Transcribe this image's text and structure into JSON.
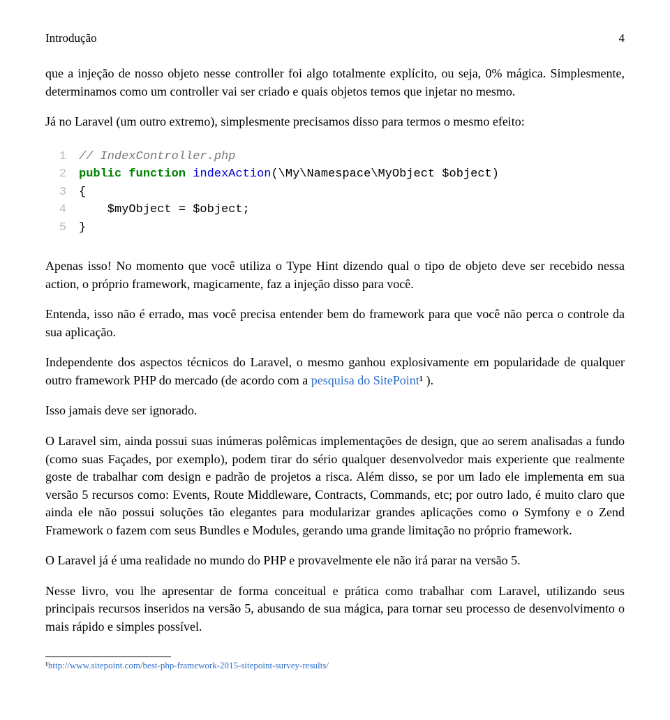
{
  "header": {
    "title": "Introdução",
    "page_number": "4"
  },
  "paragraphs": {
    "p1": "que a injeção de nosso objeto nesse controller foi algo totalmente explícito, ou seja, 0% mágica. Simplesmente, determinamos como um controller vai ser criado e quais objetos temos que injetar no mesmo.",
    "p2": "Já no Laravel (um outro extremo), simplesmente precisamos disso para termos o mesmo efeito:",
    "p3": "Apenas isso! No momento que você utiliza o Type Hint dizendo qual o tipo de objeto deve ser recebido nessa action, o próprio framework, magicamente, faz a injeção disso para você.",
    "p4": "Entenda, isso não é errado, mas você precisa entender bem do framework para que você não perca o controle da sua aplicação.",
    "p5_a": "Independente dos aspectos técnicos do Laravel, o mesmo ganhou explosivamente em popularidade de qualquer outro framework PHP do mercado (de acordo com a ",
    "p5_link": "pesquisa do SitePoint",
    "p5_sup": "¹",
    "p5_b": " ).",
    "p6": "Isso jamais deve ser ignorado.",
    "p7": "O Laravel sim, ainda possui suas inúmeras polêmicas implementações de design, que ao serem analisadas a fundo (como suas Façades, por exemplo), podem tirar do sério qualquer desenvolvedor mais experiente que realmente goste de trabalhar com design e padrão de projetos a risca. Além disso, se por um lado ele implementa em sua versão 5 recursos como: Events, Route Middleware, Contracts, Commands, etc; por outro lado, é muito claro que ainda ele não possui soluções tão elegantes para modularizar grandes aplicações como o Symfony e o Zend Framework o fazem com seus Bundles e Modules, gerando uma grande limitação no próprio framework.",
    "p8": "O Laravel já é uma realidade no mundo do PHP e provavelmente ele não irá parar na versão 5.",
    "p9": "Nesse livro, vou lhe apresentar de forma conceitual e prática como trabalhar com Laravel, utilizando seus principais recursos inseridos na versão 5, abusando de sua mágica, para tornar seu processo de desenvolvimento o mais rápido e simples possível."
  },
  "code": {
    "lines": [
      {
        "n": "1",
        "comment": "// IndexController.php"
      },
      {
        "n": "2",
        "kw1": "public",
        "kw2": "function",
        "name": " indexAction",
        "rest": "(\\My\\Namespace\\MyObject $object)"
      },
      {
        "n": "3",
        "rest": "{"
      },
      {
        "n": "4",
        "rest": "    $myObject = $object;"
      },
      {
        "n": "5",
        "rest": "}"
      }
    ]
  },
  "footnote": {
    "sup": "¹",
    "text": "http://www.sitepoint.com/best-php-framework-2015-sitepoint-survey-results/"
  }
}
